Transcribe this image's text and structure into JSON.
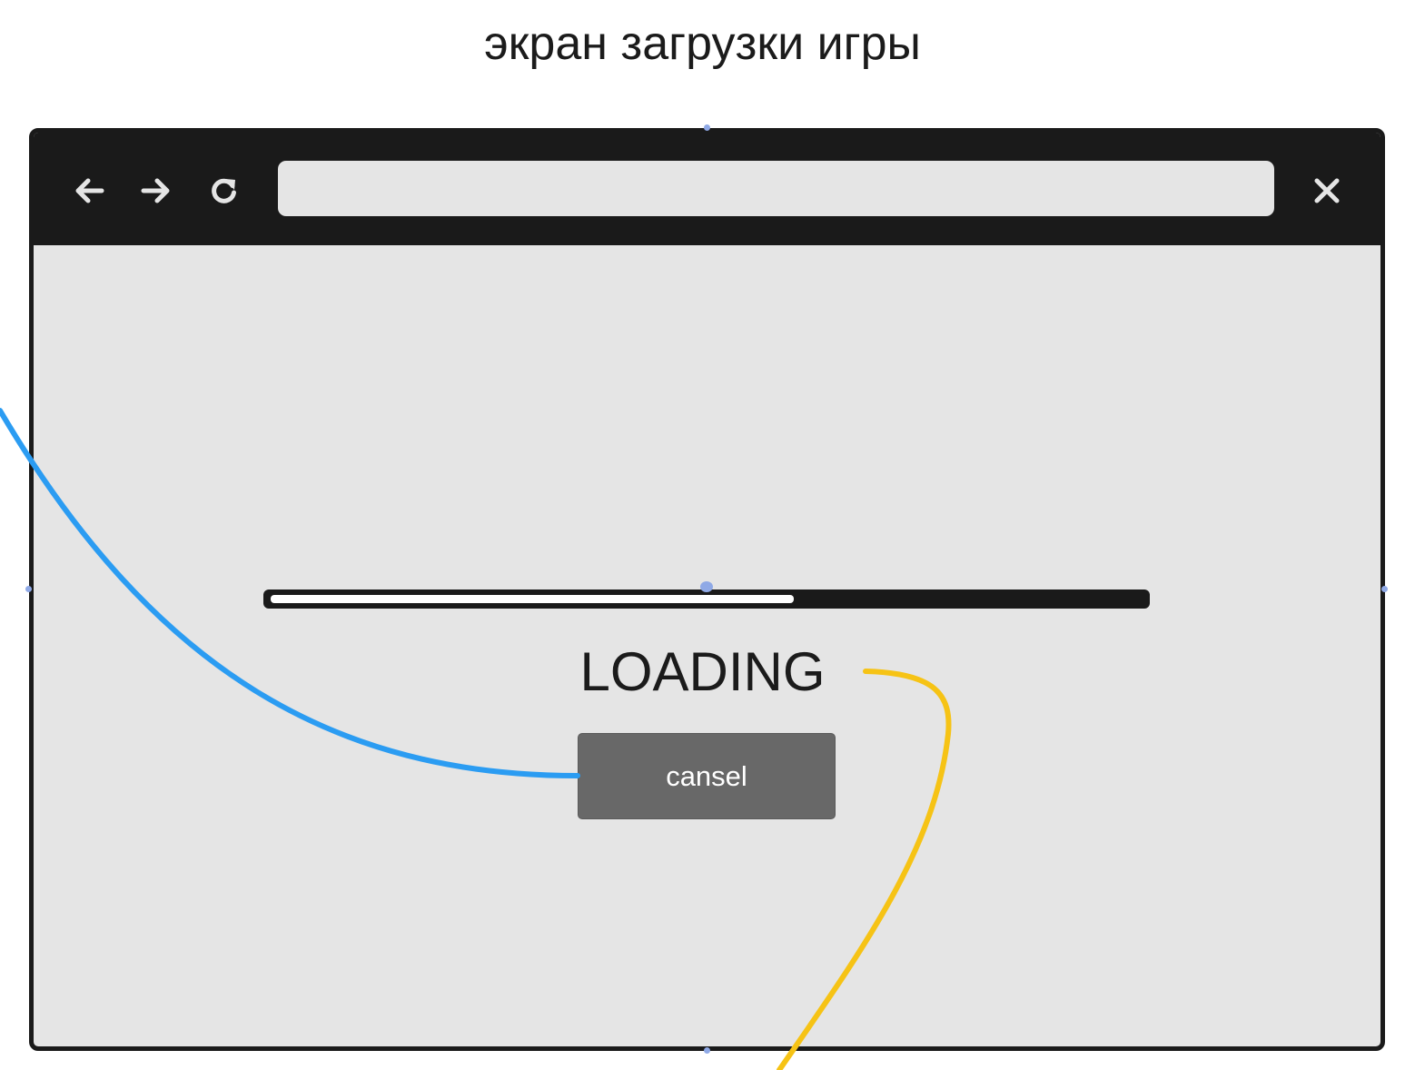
{
  "page_title": "экран загрузки игры",
  "browser": {
    "toolbar": {
      "back_icon": "arrow-left-icon",
      "forward_icon": "arrow-right-icon",
      "reload_icon": "reload-icon",
      "close_icon": "close-icon"
    },
    "address_bar": {
      "value": "",
      "placeholder": ""
    }
  },
  "loading_screen": {
    "progress": 0.6,
    "status_text": "LOADING",
    "cancel_label": "cansel"
  },
  "colors": {
    "frame": "#1a1a1a",
    "content_background": "#e5e5e5",
    "button": "#686868",
    "connector_blue": "#2b9cf2",
    "connector_yellow": "#f6c315",
    "selection_handle": "#8fa9e6"
  }
}
